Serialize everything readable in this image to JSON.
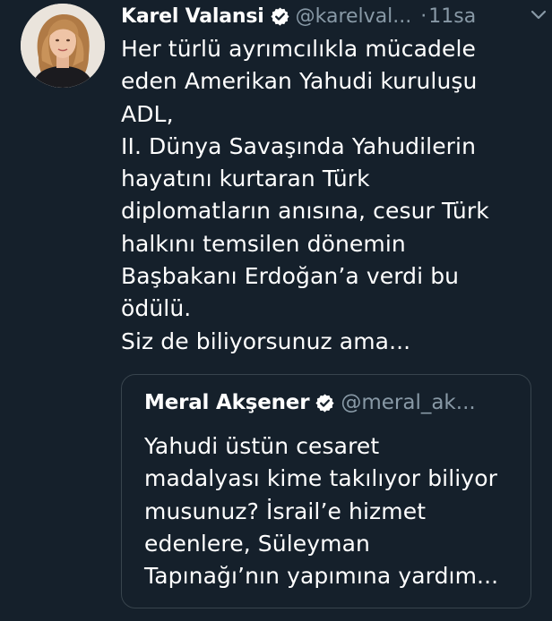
{
  "tweet": {
    "author_name": "Karel Valansi",
    "author_handle": "@karelval...",
    "separator": "·",
    "time": "11sa",
    "text": "Her türlü ayrımcılıkla mücadele\neden Amerikan Yahudi kuruluşu\nADL,\nII. Dünya Savaşında Yahudilerin\nhayatını kurtaran Türk\ndiplomatların anısına, cesur Türk\nhalkını temsilen dönemin\nBaşbakanı Erdoğan’a verdi bu\nödülü.\nSiz de biliyorsunuz ama..."
  },
  "quoted_tweet": {
    "author_name": "Meral Akşener",
    "author_handle": "@meral_ak...",
    "text": "Yahudi üstün cesaret\nmadalyası kime takılıyor biliyor\nmusunuz? İsrail’e hizmet\nedenlere, Süleyman\nTapınağı’nın yapımına yardım..."
  },
  "colors": {
    "background": "#15202b",
    "text": "#ffffff",
    "secondary_text": "#8899a6",
    "border": "#38444d"
  },
  "icons": {
    "verified": "verified-badge-icon",
    "more": "chevron-down-icon"
  }
}
